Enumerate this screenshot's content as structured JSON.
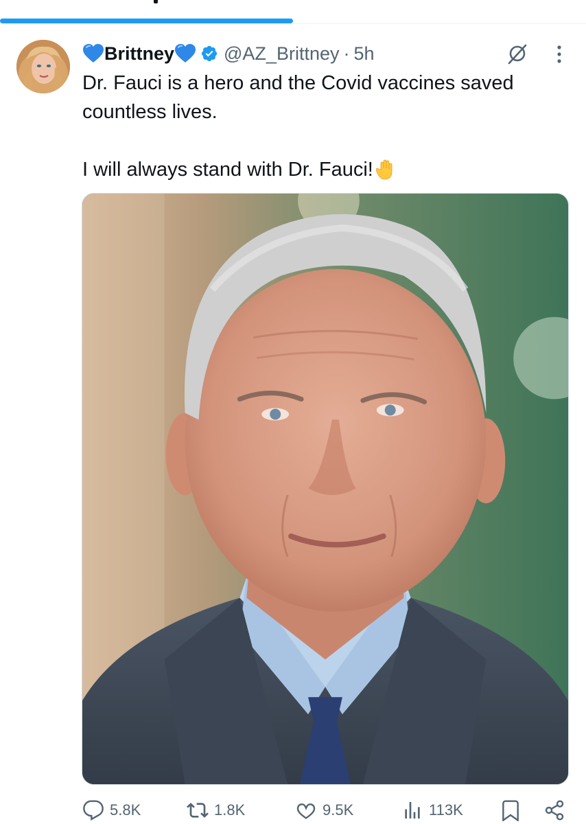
{
  "tweet": {
    "display_name": "Brittney",
    "handle": "@AZ_Brittney",
    "separator": "·",
    "time": "5h",
    "text_line1": "Dr. Fauci is a hero and the Covid vaccines saved countless lives.",
    "text_line2": "I will always stand with Dr. Fauci!"
  },
  "progress": {
    "fraction": 0.5
  },
  "actions": {
    "replies": "5.8K",
    "reposts": "1.8K",
    "likes": "9.5K",
    "views": "113K"
  },
  "colors": {
    "accent": "#1d9bf0",
    "muted": "#536471",
    "heart_emoji": "#2f88e8",
    "verified": "#1d9bf0"
  },
  "icons": [
    "blue-heart-icon",
    "verified-badge-icon",
    "grok-icon",
    "more-icon",
    "raised-hand-emoji",
    "reply-icon",
    "repost-icon",
    "like-icon",
    "views-icon",
    "bookmark-icon",
    "share-icon"
  ]
}
